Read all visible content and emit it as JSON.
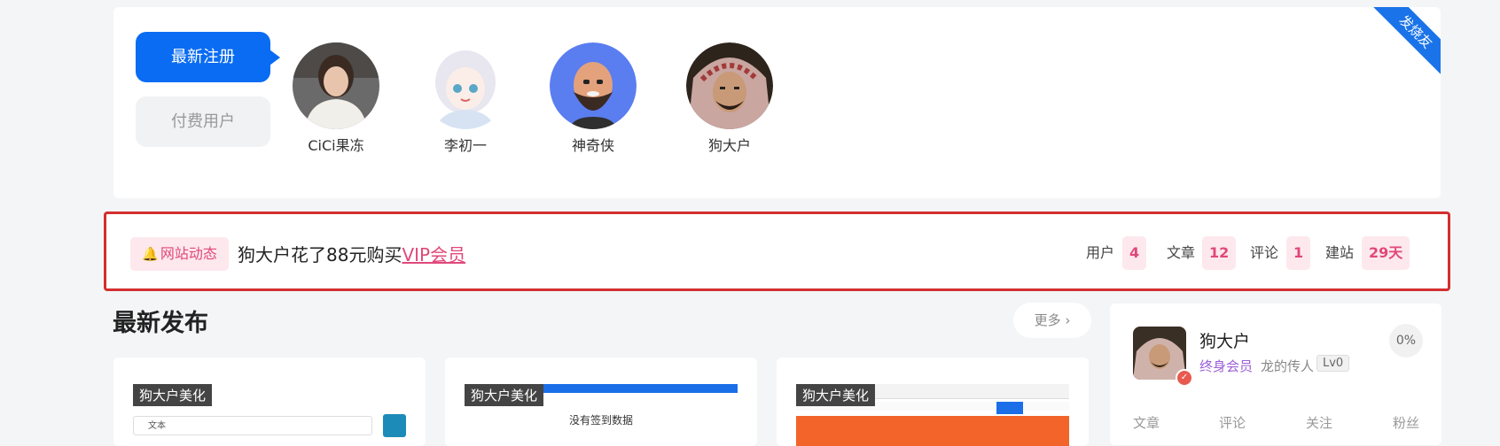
{
  "users_panel": {
    "ribbon": "发烧友",
    "tabs": [
      {
        "label": "最新注册",
        "active": true
      },
      {
        "label": "付费用户",
        "active": false
      }
    ],
    "users": [
      {
        "name": "CiCi果冻",
        "avatar": "portrait-photo"
      },
      {
        "name": "李初一",
        "avatar": "anime-girl"
      },
      {
        "name": "神奇侠",
        "avatar": "bald-bearded-cartoon"
      },
      {
        "name": "狗大户",
        "avatar": "headscarf-portrait"
      }
    ]
  },
  "news": {
    "badge_icon": "bell-icon",
    "badge": "网站动态",
    "text_prefix": "狗大户花了88元购买",
    "text_link": "VIP会员",
    "stats": [
      {
        "label": "用户",
        "value": "4"
      },
      {
        "label": "文章",
        "value": "12"
      },
      {
        "label": "评论",
        "value": "1"
      },
      {
        "label": "建站",
        "value": "29天"
      }
    ]
  },
  "latest": {
    "title": "最新发布",
    "more": "更多 ›",
    "posts": [
      {
        "tag": "狗大户美化"
      },
      {
        "tag": "狗大户美化"
      },
      {
        "tag": "狗大户美化"
      }
    ],
    "thumb_texts": {
      "select_value": "文本",
      "empty_signin": "没有签到数据"
    }
  },
  "profile": {
    "name": "狗大户",
    "vip": "终身会员",
    "title": "龙的传人",
    "level": "Lv0",
    "percent": "0%",
    "stats": [
      "文章",
      "评论",
      "关注",
      "粉丝"
    ]
  },
  "colors": {
    "accent": "#0a6cf2",
    "pink": "#e0487a",
    "highlight_border": "#d32f2f"
  }
}
